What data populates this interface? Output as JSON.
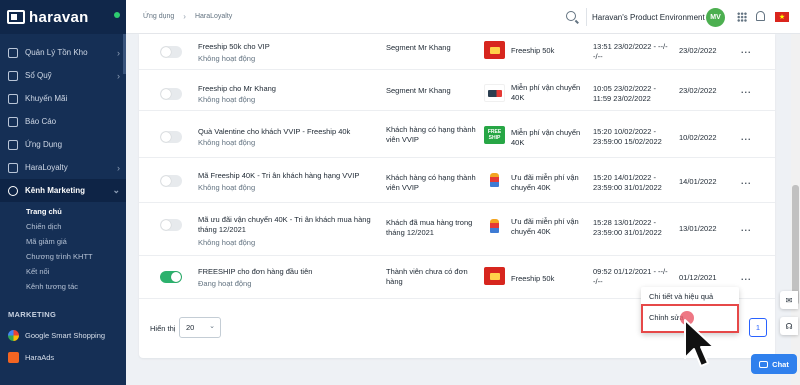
{
  "brand": {
    "name": "haravan"
  },
  "sidebar": {
    "items": [
      {
        "label": "Quản Lý Tồn Kho",
        "chevron": true
      },
      {
        "label": "Sổ Quỹ",
        "chevron": true
      },
      {
        "label": "Khuyến Mãi",
        "chevron": false
      },
      {
        "label": "Báo Cáo",
        "chevron": false
      },
      {
        "label": "Ứng Dụng",
        "chevron": false
      },
      {
        "label": "HaraLoyalty",
        "chevron": true
      },
      {
        "label": "Kênh Marketing",
        "chevron": true
      }
    ],
    "subitems": [
      {
        "label": "Trang chủ",
        "active": true
      },
      {
        "label": "Chiến dịch",
        "active": false
      },
      {
        "label": "Mã giảm giá",
        "active": false
      },
      {
        "label": "Chương trình KHTT",
        "active": false
      },
      {
        "label": "Kết nối",
        "active": false
      },
      {
        "label": "Kênh tương tác",
        "active": false
      }
    ],
    "section_label": "MARKETING",
    "apps": [
      {
        "label": "Google Smart Shopping",
        "icon": "google-icon"
      },
      {
        "label": "HaraAds",
        "icon": "haraads-icon"
      }
    ]
  },
  "topbar": {
    "breadcrumb": [
      "Ứng dụng",
      "HaraLoyalty"
    ],
    "environment": "Haravan's Product Environment",
    "avatar_initials": "MV"
  },
  "table": {
    "rows": [
      {
        "active": false,
        "title": "Freeship 50k cho VIP",
        "status": "Không hoạt động",
        "segment": "Segment Mr Khang",
        "prize_icon": "freeship-ticket",
        "prize": "Freeship 50k",
        "dates": "13:51 23/02/2022 - --/--/--",
        "created": "23/02/2022"
      },
      {
        "active": false,
        "title": "Freeship cho Mr Khang",
        "status": "Không hoạt động",
        "segment": "Segment Mr Khang",
        "prize_icon": "delivery-truck",
        "prize": "Miễn phí vận chuyển 40K",
        "dates": "10:05 23/02/2022 - 11:59 23/02/2022",
        "created": "23/02/2022"
      },
      {
        "active": false,
        "title": "Quà Valentine cho khách VVIP - Freeship 40k",
        "status": "Không hoạt động",
        "segment": "Khách hàng có hạng thành viên VVIP",
        "prize_icon": "free-ship-badge",
        "prize": "Miễn phí vận chuyển 40K",
        "dates": "15:20 10/02/2022 - 23:59:00 15/02/2022",
        "created": "10/02/2022"
      },
      {
        "active": false,
        "title": "Mã Freeship 40K - Tri ân khách hàng hạng VVIP",
        "status": "Không hoạt động",
        "segment": "Khách hàng có hạng thành viên VVIP",
        "prize_icon": "delivery-person",
        "prize": "Ưu đãi miễn phí vận chuyển 40K",
        "dates": "15:20 14/01/2022 - 23:59:00 31/01/2022",
        "created": "14/01/2022"
      },
      {
        "active": false,
        "title": "Mã ưu đãi vận chuyển 40K - Tri ân khách mua hàng tháng 12/2021",
        "status": "Không hoạt động",
        "segment": "Khách đã mua hàng trong tháng 12/2021",
        "prize_icon": "delivery-person",
        "prize": "Ưu đãi miễn phí vận chuyển 40K",
        "dates": "15:28 13/01/2022 - 23:59:00 31/01/2022",
        "created": "13/01/2022"
      },
      {
        "active": true,
        "title": "FREESHIP cho đơn hàng đầu tiên",
        "status": "Đang hoạt động",
        "segment": "Thành viên chưa có đơn hàng",
        "prize_icon": "freeship-ticket",
        "prize": "Freeship 50k",
        "dates": "09:52 01/12/2021 - --/--/--",
        "created": "01/12/2021"
      }
    ],
    "more_label": "..."
  },
  "footer": {
    "show_label": "Hiển thị",
    "page_size": "20",
    "current_page": "1"
  },
  "popup": {
    "option_details": "Chi tiết và hiệu quả",
    "option_edit": "Chỉnh sửa"
  },
  "chat": {
    "label": "Chat"
  },
  "colors": {
    "sidebar": "#152f55",
    "toggle_on": "#2cb16d",
    "highlight": "#e64848",
    "primary": "#2962ff",
    "chat": "#2f80ed"
  }
}
